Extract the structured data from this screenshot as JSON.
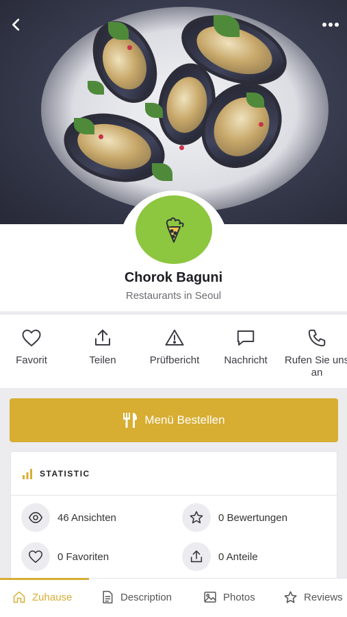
{
  "header": {
    "back_icon": "chevron-left-icon",
    "more_icon": "more-horizontal-icon"
  },
  "restaurant": {
    "name": "Chorok Baguni",
    "category": "Restaurants in Seoul",
    "logo_color": "#8dc63f"
  },
  "actions": [
    {
      "label": "Favorit",
      "icon": "heart-icon"
    },
    {
      "label": "Teilen",
      "icon": "share-icon"
    },
    {
      "label": "Prüfbericht",
      "icon": "warning-icon"
    },
    {
      "label": "Nachricht",
      "icon": "message-icon"
    },
    {
      "label": "Rufen Sie uns an",
      "icon": "phone-icon"
    }
  ],
  "order_button": {
    "label": "Menü Bestellen",
    "icon": "cutlery-icon",
    "color": "#d7ad32"
  },
  "statistic": {
    "title": "STATISTIC",
    "items": [
      {
        "text": "46 Ansichten",
        "icon": "eye-icon"
      },
      {
        "text": "0 Bewertungen",
        "icon": "star-icon"
      },
      {
        "text": "0 Favoriten",
        "icon": "heart-icon"
      },
      {
        "text": "0 Anteile",
        "icon": "share-icon"
      }
    ]
  },
  "tabs": [
    {
      "label": "Zuhause",
      "icon": "home-icon",
      "active": true
    },
    {
      "label": "Description",
      "icon": "document-icon",
      "active": false
    },
    {
      "label": "Photos",
      "icon": "image-icon",
      "active": false
    },
    {
      "label": "Reviews",
      "icon": "star-icon",
      "active": false
    }
  ],
  "accent_color": "#d7ad32"
}
